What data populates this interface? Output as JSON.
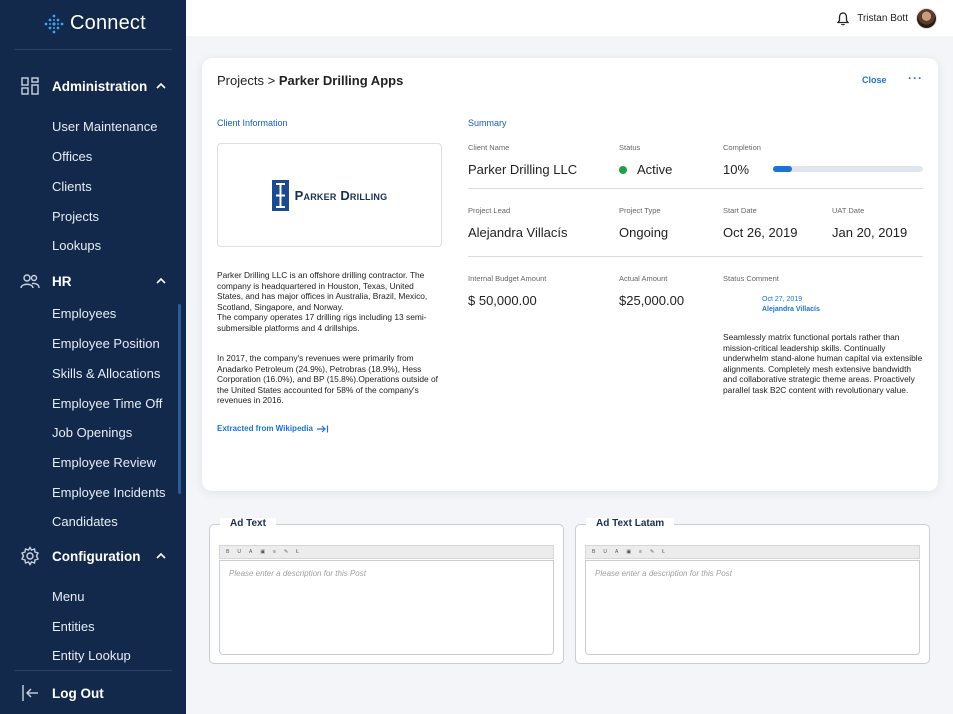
{
  "app": {
    "name": "Connect"
  },
  "sidebar": {
    "sections": [
      {
        "label": "Administration",
        "items": [
          "User Maintenance",
          "Offices",
          "Clients",
          "Projects",
          "Lookups"
        ]
      },
      {
        "label": "HR",
        "items": [
          "Employees",
          "Employee Position",
          "Skills & Allocations",
          "Employee Time Off",
          "Job Openings",
          "Employee Review",
          "Employee Incidents",
          "Candidates"
        ]
      },
      {
        "label": "Configuration",
        "items": [
          "Menu",
          "Entities",
          "Entity Lookup"
        ]
      }
    ],
    "logout": "Log Out"
  },
  "topbar": {
    "user_name": "Tristan Bott"
  },
  "breadcrumb": {
    "parent": "Projects",
    "separator": ">",
    "current": "Parker Drilling Apps"
  },
  "header_actions": {
    "close": "Close",
    "more": "···"
  },
  "client_info": {
    "title": "Client Information",
    "logo_text": "Parker Drilling",
    "paragraph1": "Parker Drilling LLC is an offshore drilling contractor. The company is headquartered in Houston, Texas, United States, and has major offices in Australia, Brazil, Mexico, Scotland, Singapore, and Norway.",
    "paragraph1b": "The company operates 17 drilling rigs including 13 semi-submersible platforms and 4 drillships.",
    "paragraph2": "In 2017, the company's revenues were primarily from Anadarko Petroleum (24.9%), Petrobras (18.9%), Hess Corporation (16.0%), and BP (15.8%).Operations outside of the United States accounted for 58% of the company's revenues in 2016.",
    "wiki_link": "Extracted from Wikipedia"
  },
  "summary": {
    "title": "Summary",
    "client_name_label": "Client Name",
    "client_name": "Parker Drilling LLC",
    "status_label": "Status",
    "status": "Active",
    "status_color": "#22a045",
    "completion_label": "Completion",
    "completion": "10%",
    "completion_fraction": 0.1,
    "project_lead_label": "Project Lead",
    "project_lead": "Alejandra Villacís",
    "project_type_label": "Project Type",
    "project_type": "Ongoing",
    "start_date_label": "Start Date",
    "start_date": "Oct 26, 2019",
    "uat_date_label": "UAT Date",
    "uat_date": "Jan 20, 2019",
    "budget_label": "Internal Budget Amount",
    "budget": "$ 50,000.00",
    "actual_label": "Actual Amount",
    "actual": "$25,000.00",
    "comment_label": "Status Comment",
    "comment_date": "Oct 27, 2019",
    "comment_author": "Alejandra Villacís",
    "comment_text": "Seamlessly matrix functional portals rather than mission-critical leadership skills. Continually underwhelm stand-alone human capital via extensible alignments. Completely mesh extensive bandwidth and collaborative strategic theme areas. Proactively parallel task B2C content with revolutionary value."
  },
  "editors": [
    {
      "title": "Ad Text",
      "placeholder": "Please enter a description for this Post"
    },
    {
      "title": "Ad Text Latam",
      "placeholder": "Please enter a description for this Post"
    }
  ],
  "toolbar_buttons": [
    "B",
    "U",
    "A",
    "▣",
    "≡",
    "✎",
    "Ł"
  ],
  "colors": {
    "sidebar": "#13294b",
    "accent": "#1a73d9",
    "active": "#22a045"
  }
}
